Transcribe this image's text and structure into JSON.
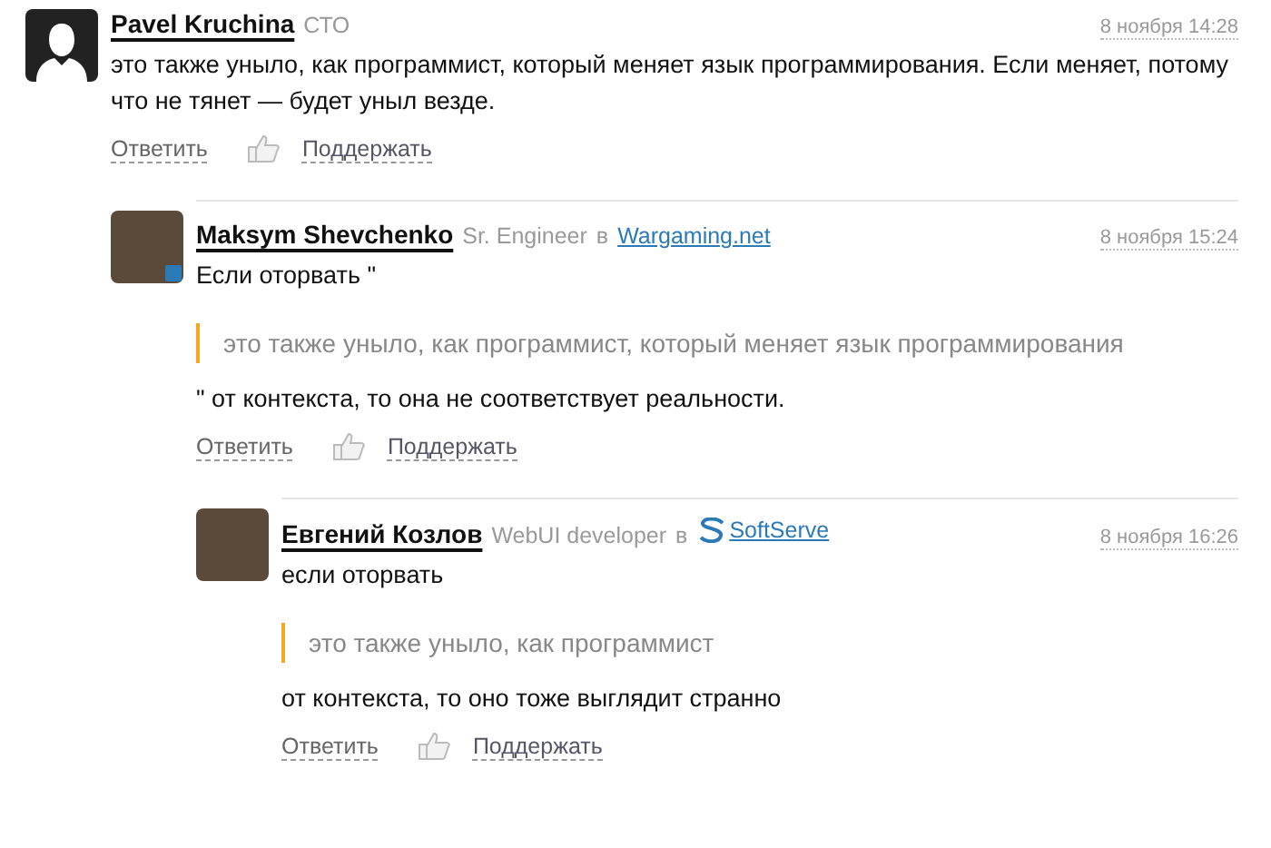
{
  "comments": [
    {
      "avatar": {
        "kind": "silhouette",
        "has_badge": false
      },
      "name": "Pavel Kruchina",
      "role": "СТО",
      "time": "8 ноября 14:28",
      "body": [
        {
          "kind": "text",
          "text": "это также уныло, как программист, который меняет язык программирования. Если меняет, потому что не тянет — будет уныл везде."
        }
      ],
      "actions": {
        "reply": "Ответить",
        "support": "Поддержать"
      },
      "children": [
        {
          "avatar": {
            "kind": "photo",
            "has_badge": true
          },
          "name": "Maksym Shevchenko",
          "role": "Sr. Engineer",
          "preposition": "в",
          "company": {
            "name": "Wargaming.net",
            "logo": false
          },
          "time": "8 ноября 15:24",
          "body": [
            {
              "kind": "text",
              "text": "Если оторвать \""
            },
            {
              "kind": "quote",
              "text": "это также уныло, как программист, который меняет язык программирования"
            },
            {
              "kind": "text",
              "text": "\" от контекста, то она не соответствует реальности."
            }
          ],
          "actions": {
            "reply": "Ответить",
            "support": "Поддержать"
          },
          "children": [
            {
              "avatar": {
                "kind": "photo",
                "has_badge": false
              },
              "name": "Евгений Козлов",
              "role": "WebUI developer",
              "preposition": "в",
              "company": {
                "name": "SoftServe",
                "logo": true
              },
              "time": "8 ноября 16:26",
              "body": [
                {
                  "kind": "text",
                  "text": "если оторвать"
                },
                {
                  "kind": "quote",
                  "text": "это также уныло, как программист"
                },
                {
                  "kind": "text",
                  "text": "от контекста, то оно тоже выглядит странно"
                }
              ],
              "actions": {
                "reply": "Ответить",
                "support": "Поддержать"
              }
            }
          ]
        }
      ]
    }
  ]
}
